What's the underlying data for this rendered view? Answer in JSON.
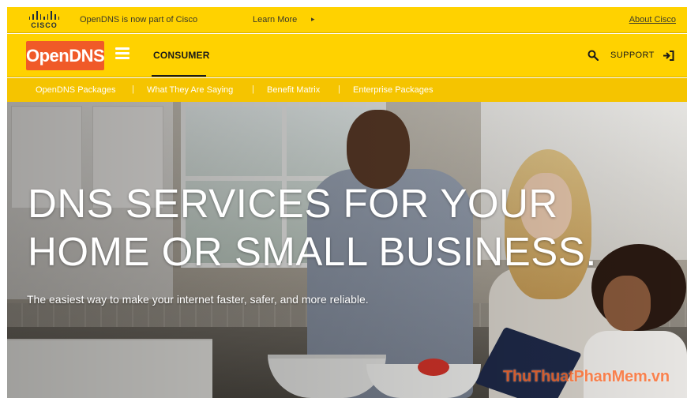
{
  "cisco_bar": {
    "logo_word": "CISCO",
    "message": "OpenDNS is now part of Cisco",
    "learn_more": "Learn More",
    "learn_more_arrow": "▸",
    "about_cisco": "About Cisco"
  },
  "main_nav": {
    "logo": "OpenDNS",
    "consumer": "CONSUMER",
    "support": "SUPPORT"
  },
  "sub_nav": {
    "items": [
      "OpenDNS Packages",
      "What They Are Saying",
      "Benefit Matrix",
      "Enterprise Packages"
    ],
    "separator": "|"
  },
  "hero": {
    "title_line1": "DNS SERVICES FOR YOUR",
    "title_line2": "HOME OR SMALL BUSINESS.",
    "subtitle": "The easiest way to make your internet faster, safer, and more reliable."
  },
  "watermark": "ThuThuatPhanMem.vn",
  "icons": {
    "logo": "cisco-logo-icon",
    "menu": "hamburger-icon",
    "search": "search-icon",
    "support": "sign-in-icon"
  },
  "colors": {
    "brand_yellow": "#ffd200",
    "sub_nav_yellow": "#f5c400",
    "logo_orange": "#f05a28",
    "text_dark": "#1a1a1a"
  }
}
